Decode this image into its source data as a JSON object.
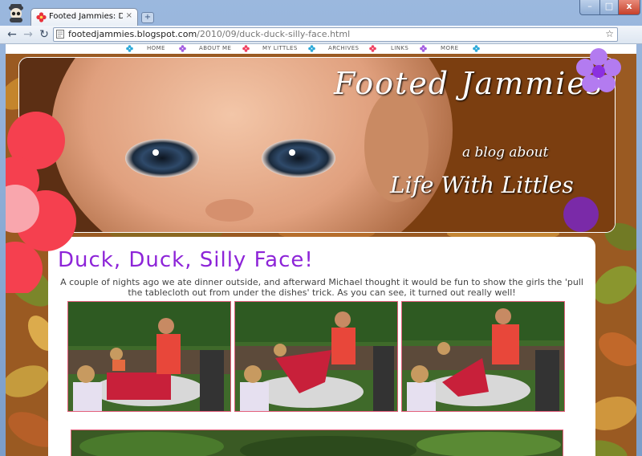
{
  "browser": {
    "tab_title": "Footed Jammies: Duck, D...",
    "tab_close": "×",
    "new_tab": "+",
    "url_host": "footedjammies.blogspot.com",
    "url_path": "/2010/09/duck-duck-silly-face.html",
    "back": "←",
    "forward": "→",
    "reload": "↻",
    "bookmark_star": "☆",
    "wrench": "🔧",
    "minimize": "–",
    "maximize": "□",
    "close": "x"
  },
  "nav": {
    "items": [
      "HOME",
      "ABOUT ME",
      "MY LITTLES",
      "ARCHIVES",
      "LINKS",
      "MORE"
    ]
  },
  "header": {
    "title": "Footed Jammies",
    "tagline": "a blog about",
    "tagline2": "Life With Littles"
  },
  "post": {
    "title": "Duck, Duck, Silly Face!",
    "body": "A couple of nights ago we ate dinner outside, and afterward Michael thought it would be fun to show the girls the 'pull the tablecloth out from under the dishes' trick. As you can see, it turned out really well!"
  },
  "colors": {
    "post_title": "#8d24d8",
    "flower_red": "#f5404f",
    "flower_purple": "#b37bf0",
    "photo_border": "#e3607c"
  },
  "icons": {
    "incognito": "incognito-icon",
    "favicon": "flower-favicon-icon",
    "page": "page-icon"
  }
}
